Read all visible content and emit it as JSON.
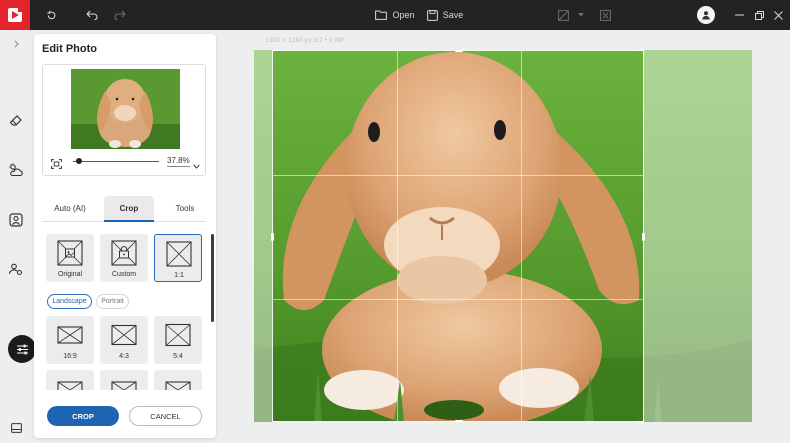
{
  "toolbar": {
    "open_label": "Open",
    "save_label": "Save"
  },
  "size_readout": "1920 × 1280 px  3:2  • 1 MP",
  "panel": {
    "title": "Edit Photo",
    "zoom_value": "37.8%",
    "zoom_fraction": 0.07,
    "tabs": [
      {
        "label": "Auto (AI)"
      },
      {
        "label": "Crop"
      },
      {
        "label": "Tools"
      }
    ],
    "presets": [
      {
        "label": "Original"
      },
      {
        "label": "Custom"
      },
      {
        "label": "1:1"
      }
    ],
    "orientation": {
      "landscape": "Landscape",
      "portrait": "Portrait"
    },
    "ratios": [
      {
        "label": "16:9"
      },
      {
        "label": "4:3"
      },
      {
        "label": "5:4"
      }
    ],
    "crop_button": "CROP",
    "cancel_button": "CANCEL"
  },
  "colors": {
    "accent": "#1e64b0",
    "topbar": "#232323",
    "logo": "#e3242b"
  }
}
